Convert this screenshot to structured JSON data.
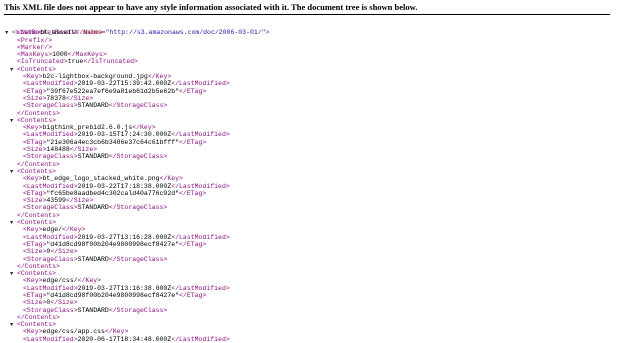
{
  "header": {
    "message": "This XML file does not appear to have any style information associated with it. The document tree is shown below."
  },
  "root": {
    "open": "<ListBucketResult ",
    "attr_name": "xmlns",
    "attr_eq": "=",
    "attr_value": "\"http://s3.amazonaws.com/doc/2006-03-01/\"",
    "open_close": ">",
    "toggle": "▼"
  },
  "fields": [
    {
      "open": "<Name>",
      "value": "bt_assets",
      "close": "</Name>"
    },
    {
      "open": "<Prefix/>",
      "value": "",
      "close": ""
    },
    {
      "open": "<Marker/>",
      "value": "",
      "close": ""
    },
    {
      "open": "<MaxKeys>",
      "value": "1000",
      "close": "</MaxKeys>"
    },
    {
      "open": "<IsTruncated>",
      "value": "true",
      "close": "</IsTruncated>"
    }
  ],
  "contents_open": "<Contents>",
  "contents_close": "</Contents>",
  "toggle_glyph": "▼",
  "contents": [
    {
      "rows": [
        {
          "open": "<Key>",
          "value": "b2c-lightbox-background.jpg",
          "close": "</Key>"
        },
        {
          "open": "<LastModified>",
          "value": "2019-03-22T15:39:42.000Z",
          "close": "</LastModified>"
        },
        {
          "open": "<ETag>",
          "value": "\"39f67e522ea7ef6e9a81eb61d2b5e62b\"",
          "close": "</ETag>"
        },
        {
          "open": "<Size>",
          "value": "78378",
          "close": "</Size>"
        },
        {
          "open": "<StorageClass>",
          "value": "STANDARD",
          "close": "</StorageClass>"
        }
      ]
    },
    {
      "rows": [
        {
          "open": "<Key>",
          "value": "bigthink_prebid2.6.0.js",
          "close": "</Key>"
        },
        {
          "open": "<LastModified>",
          "value": "2019-03-15T17:24:30.000Z",
          "close": "</LastModified>"
        },
        {
          "open": "<ETag>",
          "value": "\"21e306a4ec3cb6b3486e37c64c61bfff\"",
          "close": "</ETag>"
        },
        {
          "open": "<Size>",
          "value": "148488",
          "close": "</Size>"
        },
        {
          "open": "<StorageClass>",
          "value": "STANDARD",
          "close": "</StorageClass>"
        }
      ]
    },
    {
      "rows": [
        {
          "open": "<Key>",
          "value": "bt_edge_logo_stacked_white.png",
          "close": "</Key>"
        },
        {
          "open": "<LastModified>",
          "value": "2019-03-22T17:18:38.000Z",
          "close": "</LastModified>"
        },
        {
          "open": "<ETag>",
          "value": "\"fc65be8aadbed4c302cald40a776c92d\"",
          "close": "</ETag>"
        },
        {
          "open": "<Size>",
          "value": "43599",
          "close": "</Size>"
        },
        {
          "open": "<StorageClass>",
          "value": "STANDARD",
          "close": "</StorageClass>"
        }
      ]
    },
    {
      "rows": [
        {
          "open": "<Key>",
          "value": "edge/",
          "close": "</Key>"
        },
        {
          "open": "<LastModified>",
          "value": "2019-03-27T13:16:28.000Z",
          "close": "</LastModified>"
        },
        {
          "open": "<ETag>",
          "value": "\"d41d8cd98f00b204e9800998ecf8427e\"",
          "close": "</ETag>"
        },
        {
          "open": "<Size>",
          "value": "0",
          "close": "</Size>"
        },
        {
          "open": "<StorageClass>",
          "value": "STANDARD",
          "close": "</StorageClass>"
        }
      ]
    },
    {
      "rows": [
        {
          "open": "<Key>",
          "value": "edge/css/",
          "close": "</Key>"
        },
        {
          "open": "<LastModified>",
          "value": "2019-03-27T13:16:38.000Z",
          "close": "</LastModified>"
        },
        {
          "open": "<ETag>",
          "value": "\"d41d8cd98f00b204e9800998ecf8427e\"",
          "close": "</ETag>"
        },
        {
          "open": "<Size>",
          "value": "0",
          "close": "</Size>"
        },
        {
          "open": "<StorageClass>",
          "value": "STANDARD",
          "close": "</StorageClass>"
        }
      ]
    },
    {
      "rows": [
        {
          "open": "<Key>",
          "value": "edge/css/app.css",
          "close": "</Key>"
        },
        {
          "open": "<LastModified>",
          "value": "2020-06-17T18:34:48.000Z",
          "close": "</LastModified>"
        }
      ]
    }
  ]
}
